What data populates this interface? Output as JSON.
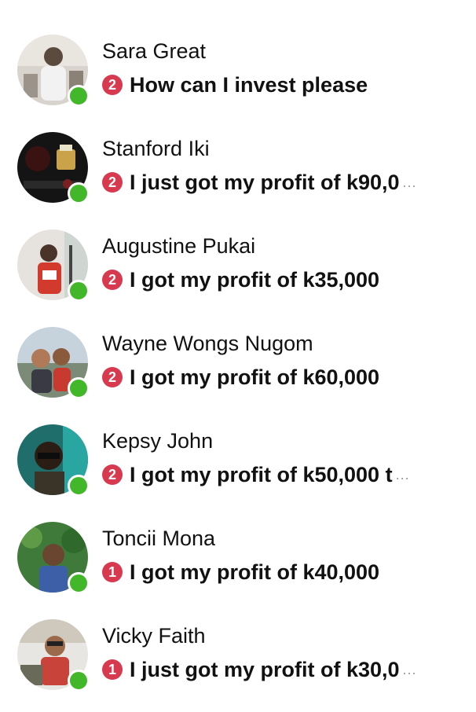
{
  "colors": {
    "online": "#42b72a",
    "badge": "#d9394f",
    "text": "#111111"
  },
  "chats": [
    {
      "name": "Sara Great",
      "unread": "2",
      "preview": "How can I invest please",
      "truncated": false,
      "online": true
    },
    {
      "name": "Stanford Iki",
      "unread": "2",
      "preview": "I just got my profit of k90,0",
      "truncated": true,
      "online": true
    },
    {
      "name": "Augustine Pukai",
      "unread": "2",
      "preview": "I got my profit of k35,000",
      "truncated": false,
      "online": true
    },
    {
      "name": "Wayne Wongs Nugom",
      "unread": "2",
      "preview": "I got my profit of k60,000",
      "truncated": false,
      "online": true
    },
    {
      "name": "Kepsy John",
      "unread": "2",
      "preview": "I got my profit of k50,000 t",
      "truncated": true,
      "online": true
    },
    {
      "name": "Toncii Mona",
      "unread": "1",
      "preview": "I got my profit of k40,000",
      "truncated": false,
      "online": true
    },
    {
      "name": "Vicky Faith",
      "unread": "1",
      "preview": "I just got my profit of k30,0",
      "truncated": true,
      "online": true
    }
  ]
}
